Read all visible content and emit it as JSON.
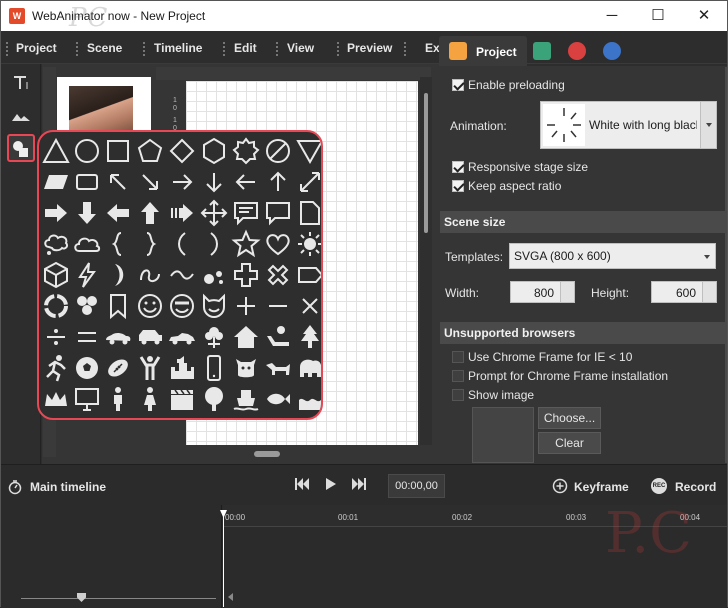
{
  "window": {
    "title": "WebAnimator now - New Project",
    "watermark": "PC",
    "controls": {
      "minimize": "─",
      "maximize": "☐",
      "close": "✕"
    }
  },
  "menu": [
    "Project",
    "Scene",
    "Timeline",
    "Edit",
    "View",
    "Preview",
    "Ex"
  ],
  "tabs": [
    {
      "label": "Project",
      "icon": "html5-icon",
      "color": "#f4a340"
    },
    {
      "label": "",
      "icon": "film-icon",
      "color": "#3aa37a"
    },
    {
      "label": "",
      "icon": "move-icon",
      "color": "#d94040"
    },
    {
      "label": "",
      "icon": "magic-wand-icon",
      "color": "#3b74c9"
    }
  ],
  "left_tools": [
    "text-tool-icon",
    "image-tool-icon",
    "shapes-tool-icon"
  ],
  "rulers": {
    "vertical": [
      "1",
      "0",
      "1",
      "0"
    ]
  },
  "project": {
    "enable_preloading": "Enable preloading",
    "animation_label": "Animation:",
    "animation_value": "White with long black",
    "responsive": "Responsive stage size",
    "keep_aspect": "Keep aspect ratio",
    "scene_size_header": "Scene size",
    "templates_label": "Templates:",
    "templates_value": "SVGA (800 x 600)",
    "width_label": "Width:",
    "width_value": "800",
    "height_label": "Height:",
    "height_value": "600",
    "unsupported_header": "Unsupported browsers",
    "chrome_frame": "Use Chrome Frame for IE < 10",
    "prompt_chrome": "Prompt for Chrome Frame installation",
    "show_image": "Show image",
    "choose_button": "Choose...",
    "clear_button": "Clear"
  },
  "timeline": {
    "label": "Main timeline",
    "timecode": "00:00,00",
    "keyframe": "Keyframe",
    "record": "Record",
    "ticks": [
      "00:00",
      "00:01",
      "00:02",
      "00:03",
      "00:04"
    ]
  }
}
